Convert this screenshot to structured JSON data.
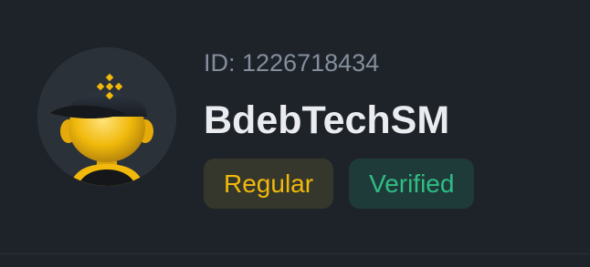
{
  "profile": {
    "avatar_icon": "binance-cap-character-avatar",
    "id_label": "ID: 1226718434",
    "username": "BdebTechSM",
    "badges": {
      "regular": "Regular",
      "verified": "Verified"
    }
  },
  "colors": {
    "background": "#1e2329",
    "brand_yellow": "#f0b90b",
    "verified_green": "#2ebd85",
    "muted_text": "#848e9c",
    "primary_text": "#eaecef"
  }
}
